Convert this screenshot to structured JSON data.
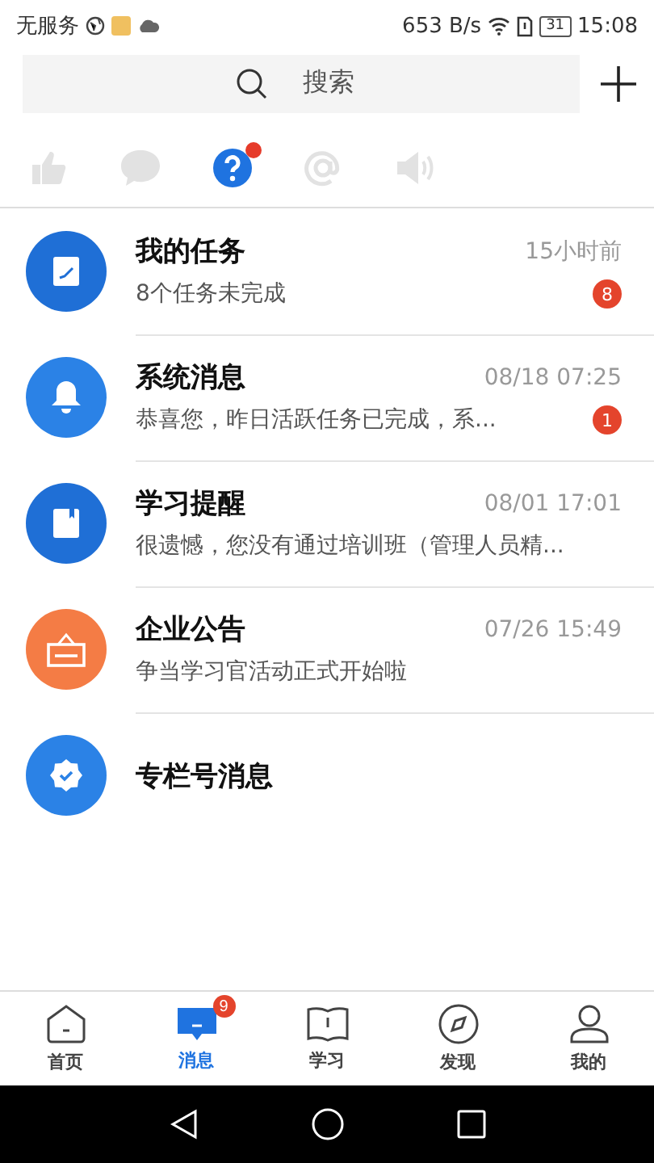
{
  "status_bar": {
    "carrier": "无服务",
    "speed": "653 B/s",
    "battery": "31",
    "time": "15:08"
  },
  "search": {
    "placeholder": "搜索"
  },
  "categories": [
    {
      "kind": "like",
      "selected": false,
      "dot": false
    },
    {
      "kind": "chat",
      "selected": false,
      "dot": false
    },
    {
      "kind": "question",
      "selected": true,
      "dot": true
    },
    {
      "kind": "at",
      "selected": false,
      "dot": false
    },
    {
      "kind": "speaker",
      "selected": false,
      "dot": false
    }
  ],
  "messages": [
    {
      "kind": "task",
      "color": "#1f6fd6",
      "title": "我的任务",
      "time": "15小时前",
      "preview": "8个任务未完成",
      "badge": "8"
    },
    {
      "kind": "bell",
      "color": "#2b82e6",
      "title": "系统消息",
      "time": "08/18 07:25",
      "preview": "恭喜您，昨日活跃任务已完成，系...",
      "badge": "1"
    },
    {
      "kind": "book",
      "color": "#1f6fd6",
      "title": "学习提醒",
      "time": "08/01 17:01",
      "preview": "很遗憾，您没有通过培训班（管理人员精..."
    },
    {
      "kind": "board",
      "color": "#f47c45",
      "title": "企业公告",
      "time": "07/26 15:49",
      "preview": "争当学习官活动正式开始啦"
    },
    {
      "kind": "badge",
      "color": "#2b82e6",
      "title": "专栏号消息"
    }
  ],
  "tabs": [
    {
      "kind": "home",
      "label": "首页",
      "selected": false
    },
    {
      "kind": "message",
      "label": "消息",
      "selected": true,
      "badge": "9"
    },
    {
      "kind": "book",
      "label": "学习",
      "selected": false
    },
    {
      "kind": "compass",
      "label": "发现",
      "selected": false
    },
    {
      "kind": "person",
      "label": "我的",
      "selected": false
    }
  ]
}
